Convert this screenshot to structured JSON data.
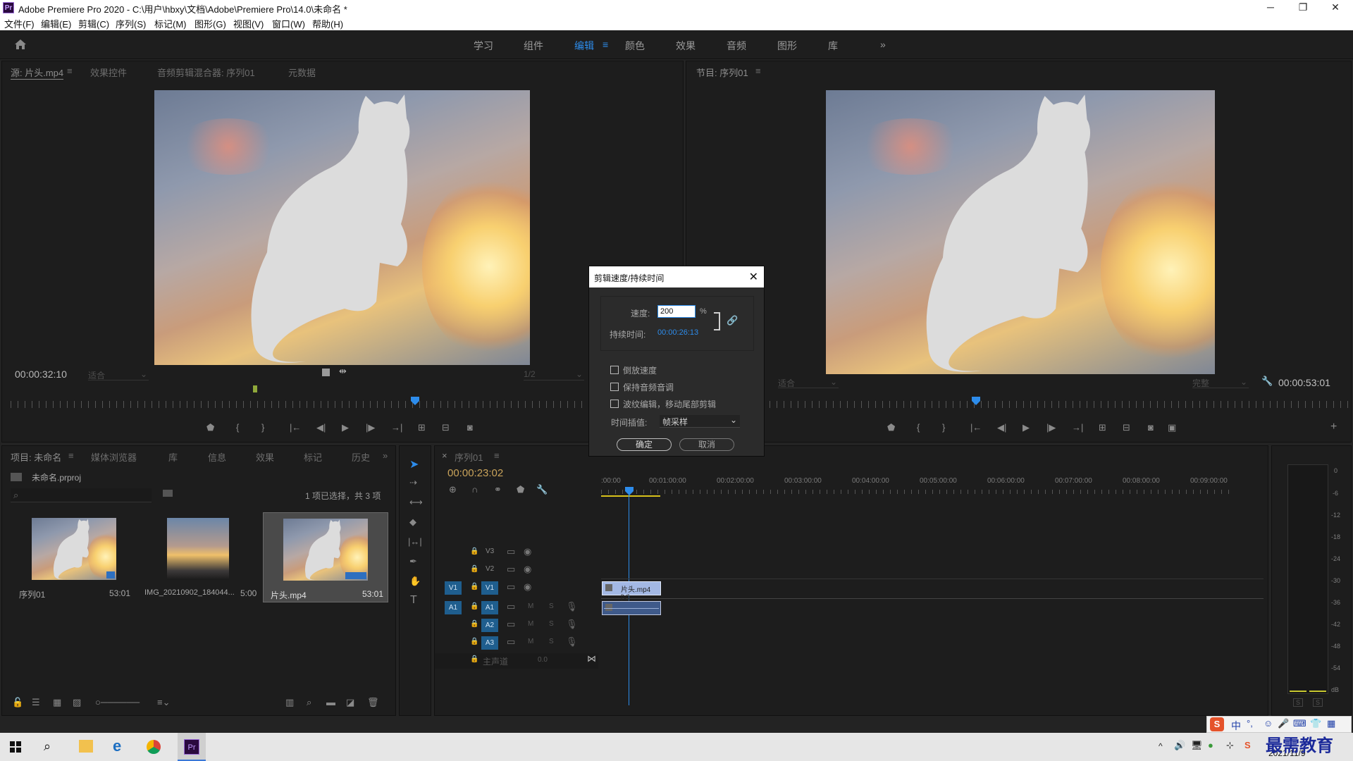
{
  "window": {
    "app_icon": "Pr",
    "title": "Adobe Premiere Pro 2020 - C:\\用户\\hbxy\\文档\\Adobe\\Premiere Pro\\14.0\\未命名 *",
    "minimize": "─",
    "maximize": "❐",
    "close": "✕"
  },
  "menu": [
    "文件(F)",
    "编辑(E)",
    "剪辑(C)",
    "序列(S)",
    "标记(M)",
    "图形(G)",
    "视图(V)",
    "窗口(W)",
    "帮助(H)"
  ],
  "workspaces": {
    "items": [
      "学习",
      "组件",
      "编辑",
      "颜色",
      "效果",
      "音频",
      "图形",
      "库"
    ],
    "active": "编辑",
    "more": "»"
  },
  "source_panel": {
    "tabs": [
      "源: 片头.mp4",
      "效果控件",
      "音频剪辑混合器: 序列01",
      "元数据"
    ],
    "timecode": "00:00:32:10",
    "fit": "适合",
    "resolution": "1/2"
  },
  "program_panel": {
    "tab": "节目: 序列01",
    "fit": "适合",
    "quality": "完整",
    "timecode": "00:00:53:01"
  },
  "project_panel": {
    "tabs": [
      "项目: 未命名",
      "媒体浏览器",
      "库",
      "信息",
      "效果",
      "标记",
      "历史"
    ],
    "project_file": "未命名.prproj",
    "search_placeholder": "",
    "selection": "1 项已选择，共 3 项",
    "items": [
      {
        "name": "序列01",
        "duration": "53:01"
      },
      {
        "name": "IMG_20210902_184044...",
        "duration": "5:00"
      },
      {
        "name": "片头.mp4",
        "duration": "53:01"
      }
    ]
  },
  "timeline": {
    "tab": "序列01",
    "timecode": "00:00:23:02",
    "ruler_labels": [
      ":00:00",
      "00:01:00:00",
      "00:02:00:00",
      "00:03:00:00",
      "00:04:00:00",
      "00:05:00:00",
      "00:06:00:00",
      "00:07:00:00",
      "00:08:00:00",
      "00:09:00:00"
    ],
    "video_tracks": [
      "V3",
      "V2",
      "V1"
    ],
    "audio_tracks": [
      "A1",
      "A2",
      "A3"
    ],
    "source_v": "V1",
    "source_a": "A1",
    "master_track": "主声道",
    "master_value": "0.0",
    "mute": "M",
    "solo": "S",
    "clip_name": "片头.mp4 [V]"
  },
  "meter": {
    "labels": [
      "0",
      "-6",
      "-12",
      "-18",
      "-24",
      "-30",
      "-36",
      "-42",
      "-48",
      "-54",
      "dB"
    ],
    "solo": [
      "S",
      "S"
    ]
  },
  "dialog": {
    "title": "剪辑速度/持续时间",
    "speed_label": "速度:",
    "speed_value": "200",
    "speed_unit": "%",
    "duration_label": "持续时间:",
    "duration_value": "00:00:26:13",
    "reverse": "倒放速度",
    "maintain_pitch": "保持音频音调",
    "ripple": "波纹编辑，移动尾部剪辑",
    "interp_label": "时间插值:",
    "interp_value": "帧采样",
    "ok": "确定",
    "cancel": "取消"
  },
  "taskbar": {
    "ime": "中",
    "date": "2021/11/9",
    "watermark": "最需教育"
  }
}
